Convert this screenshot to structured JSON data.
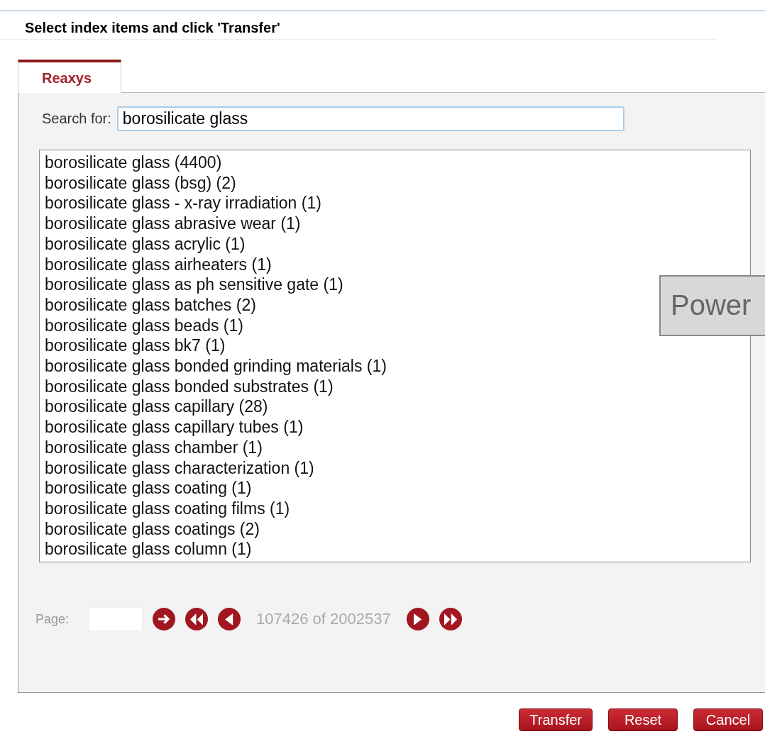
{
  "dialog": {
    "title": "Select index items and click 'Transfer'"
  },
  "tabs": [
    {
      "label": "Reaxys",
      "selected": true
    }
  ],
  "search": {
    "label": "Search for:",
    "value": "borosilicate glass"
  },
  "results": [
    {
      "text": "borosilicate glass (4400)"
    },
    {
      "text": "borosilicate glass (bsg) (2)"
    },
    {
      "text": "borosilicate glass - x-ray irradiation (1)"
    },
    {
      "text": "borosilicate glass abrasive wear (1)"
    },
    {
      "text": "borosilicate glass acrylic (1)"
    },
    {
      "text": "borosilicate glass airheaters (1)"
    },
    {
      "text": "borosilicate glass as ph sensitive gate (1)"
    },
    {
      "text": "borosilicate glass batches (2)"
    },
    {
      "text": "borosilicate glass beads (1)"
    },
    {
      "text": "borosilicate glass bk7 (1)"
    },
    {
      "text": "borosilicate glass bonded grinding materials (1)"
    },
    {
      "text": "borosilicate glass bonded substrates (1)"
    },
    {
      "text": "borosilicate glass capillary (28)"
    },
    {
      "text": "borosilicate glass capillary tubes (1)"
    },
    {
      "text": "borosilicate glass chamber (1)"
    },
    {
      "text": "borosilicate glass characterization (1)"
    },
    {
      "text": "borosilicate glass coating (1)"
    },
    {
      "text": "borosilicate glass coating films (1)"
    },
    {
      "text": "borosilicate glass coatings (2)"
    },
    {
      "text": "borosilicate glass column (1)"
    }
  ],
  "pager": {
    "label": "Page:",
    "buttons": [
      {
        "kind": "go"
      },
      {
        "kind": "first"
      },
      {
        "kind": "prev"
      }
    ],
    "range": "107426 of 2002537",
    "buttons_after": [
      {
        "kind": "next"
      },
      {
        "kind": "last"
      }
    ]
  },
  "overlay_label": "Power",
  "buttons": [
    "Transfer",
    "Reset",
    "Cancel"
  ]
}
